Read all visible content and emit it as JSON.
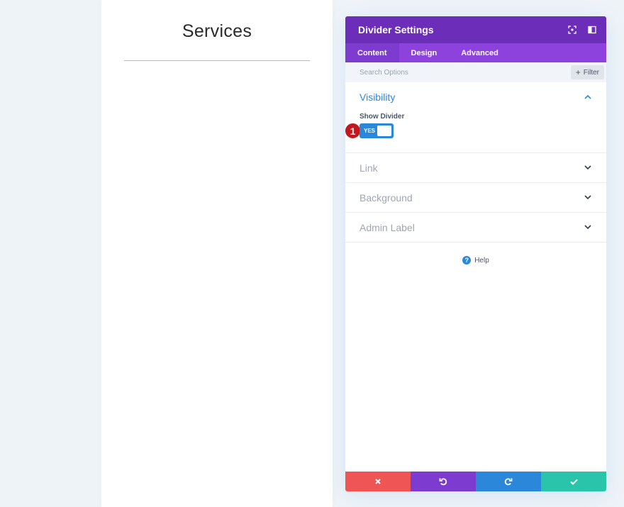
{
  "page": {
    "heading": "Services"
  },
  "modal": {
    "title": "Divider Settings",
    "tabs": [
      {
        "label": "Content",
        "active": true
      },
      {
        "label": "Design",
        "active": false
      },
      {
        "label": "Advanced",
        "active": false
      }
    ],
    "search": {
      "placeholder": "Search Options",
      "value": ""
    },
    "filter_label": "Filter",
    "sections": [
      {
        "title": "Visibility",
        "open": true
      },
      {
        "title": "Link",
        "open": false
      },
      {
        "title": "Background",
        "open": false
      },
      {
        "title": "Admin Label",
        "open": false
      }
    ],
    "show_divider": {
      "label": "Show Divider",
      "toggle_text": "YES",
      "enabled": true
    },
    "step_badge": "1",
    "help_label": "Help",
    "help_icon_text": "?"
  },
  "colors": {
    "header": "#6c2eb9",
    "tabs": "#8e42dd",
    "accent_blue": "#2b87da",
    "discard": "#ef5555",
    "undo": "#7e3bd0",
    "redo": "#2b87da",
    "save": "#29c4a9",
    "badge": "#c4161c"
  },
  "icons": {
    "header": [
      "fullscreen-icon",
      "sidebar-layout-icon"
    ],
    "footer": [
      "close-icon",
      "undo-icon",
      "redo-icon",
      "check-icon"
    ]
  }
}
